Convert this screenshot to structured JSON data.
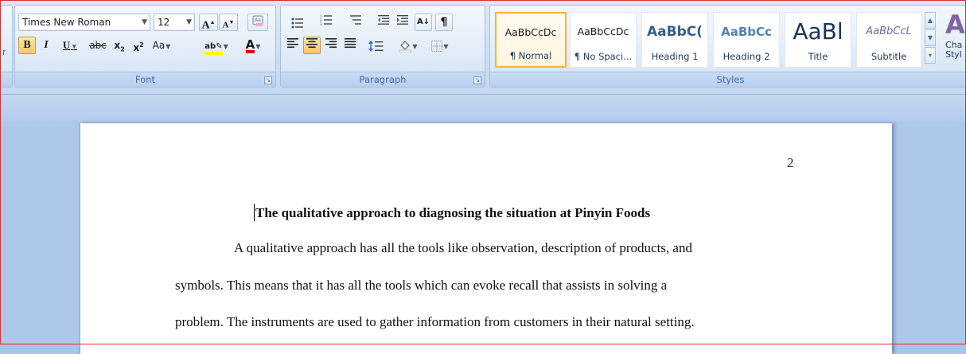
{
  "ribbon": {
    "font": {
      "group_label": "Font",
      "font_name": "Times New Roman",
      "font_size": "12",
      "bold": "B",
      "italic": "I",
      "underline": "U",
      "strikethrough": "abc",
      "subscript": "x",
      "subscript_mark": "2",
      "superscript": "x",
      "superscript_mark": "2",
      "change_case": "Aa",
      "grow_font": "A",
      "shrink_font": "A",
      "highlight_text": "ab",
      "font_color": "A",
      "highlight_color": "#ffff00",
      "font_color_value": "#e00000"
    },
    "paragraph": {
      "group_label": "Paragraph",
      "sort": "A↓",
      "show_marks": "¶"
    },
    "styles": {
      "group_label": "Styles",
      "items": [
        {
          "preview": "AaBbCcDc",
          "label": "¶ Normal"
        },
        {
          "preview": "AaBbCcDc",
          "label": "¶ No Spaci..."
        },
        {
          "preview": "AaBbC(",
          "label": "Heading 1"
        },
        {
          "preview": "AaBbCc",
          "label": "Heading 2"
        },
        {
          "preview": "AaBl",
          "label": "Title"
        },
        {
          "preview": "AaBbCcL",
          "label": "Subtitle"
        }
      ],
      "change_styles_line1": "Cha",
      "change_styles_line2": "Styl",
      "change_styles_glyph": "A"
    },
    "left_edge_label": "r"
  },
  "document": {
    "page_number": "2",
    "title": "The qualitative approach to diagnosing the situation  at Pinyin Foods",
    "lines": [
      "A qualitative approach has all the tools like observation, description of products, and",
      "symbols. This  means that it has all the tools which can evoke recall  that assists in solving a",
      "problem. The instruments are used to gather information from customers in their natural setting."
    ]
  },
  "colors": {
    "accent": "#15428b",
    "selected_style_border": "#f3b437",
    "heading_blue": "#4f81bd",
    "heading_blue_dark": "#365f91",
    "subtitle_purple": "#8064a2"
  }
}
